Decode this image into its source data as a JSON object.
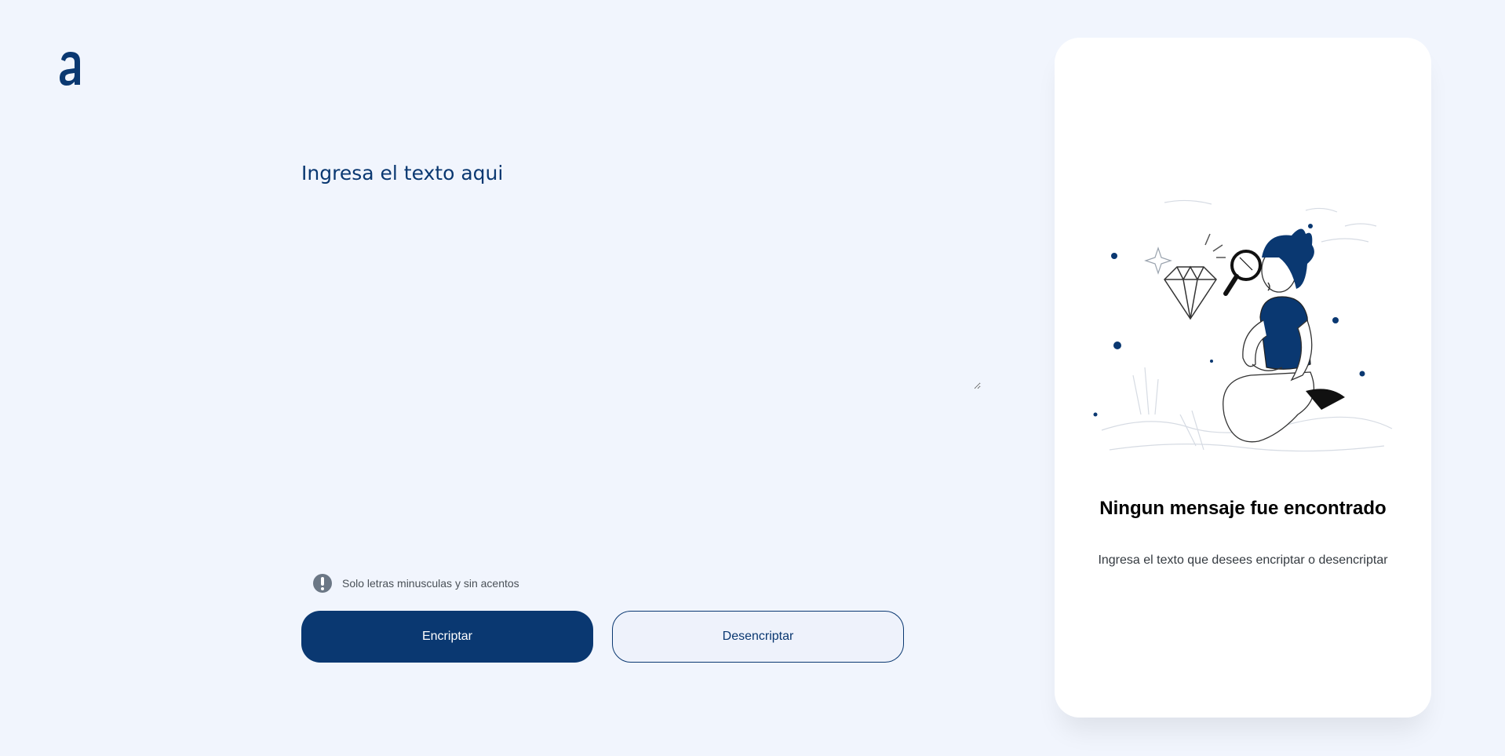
{
  "logo": {
    "icon": "alura-a-logo-icon",
    "color": "#0a3871"
  },
  "editor": {
    "placeholder": "Ingresa el texto aqui",
    "value": ""
  },
  "hint": {
    "icon": "exclamation-circle-icon",
    "text": "Solo letras minusculas y sin acentos"
  },
  "buttons": {
    "encrypt": "Encriptar",
    "decrypt": "Desencriptar"
  },
  "panel": {
    "illustration": "person-with-magnifier-illustration",
    "title": "Ningun mensaje fue encontrado",
    "subtitle": "Ingresa el texto que desees encriptar o desencriptar"
  },
  "colors": {
    "accent": "#0a3871",
    "background": "#f1f5fd",
    "panel": "#ffffff"
  }
}
